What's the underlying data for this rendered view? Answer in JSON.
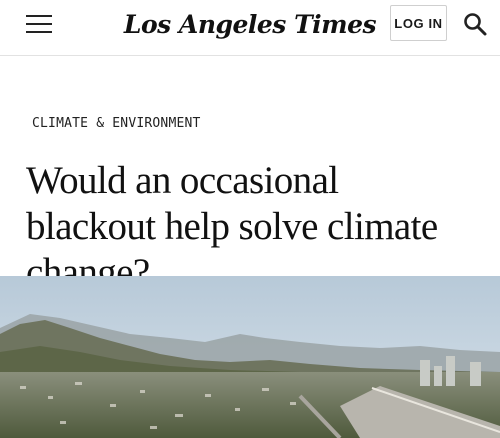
{
  "header": {
    "masthead": "Los Angeles Times",
    "login_label": "LOG IN",
    "menu_icon": "hamburger-menu-icon",
    "search_icon": "search-icon"
  },
  "article": {
    "section": "CLIMATE & ENVIRONMENT",
    "headline": "Would an occasional blackout help solve climate change?"
  },
  "hero_image": {
    "subject": "hazy aerial view of a city below mountains with a freeway"
  },
  "colors": {
    "text": "#111111",
    "border": "#cfcfcf",
    "sky": "#c9d8e4"
  }
}
